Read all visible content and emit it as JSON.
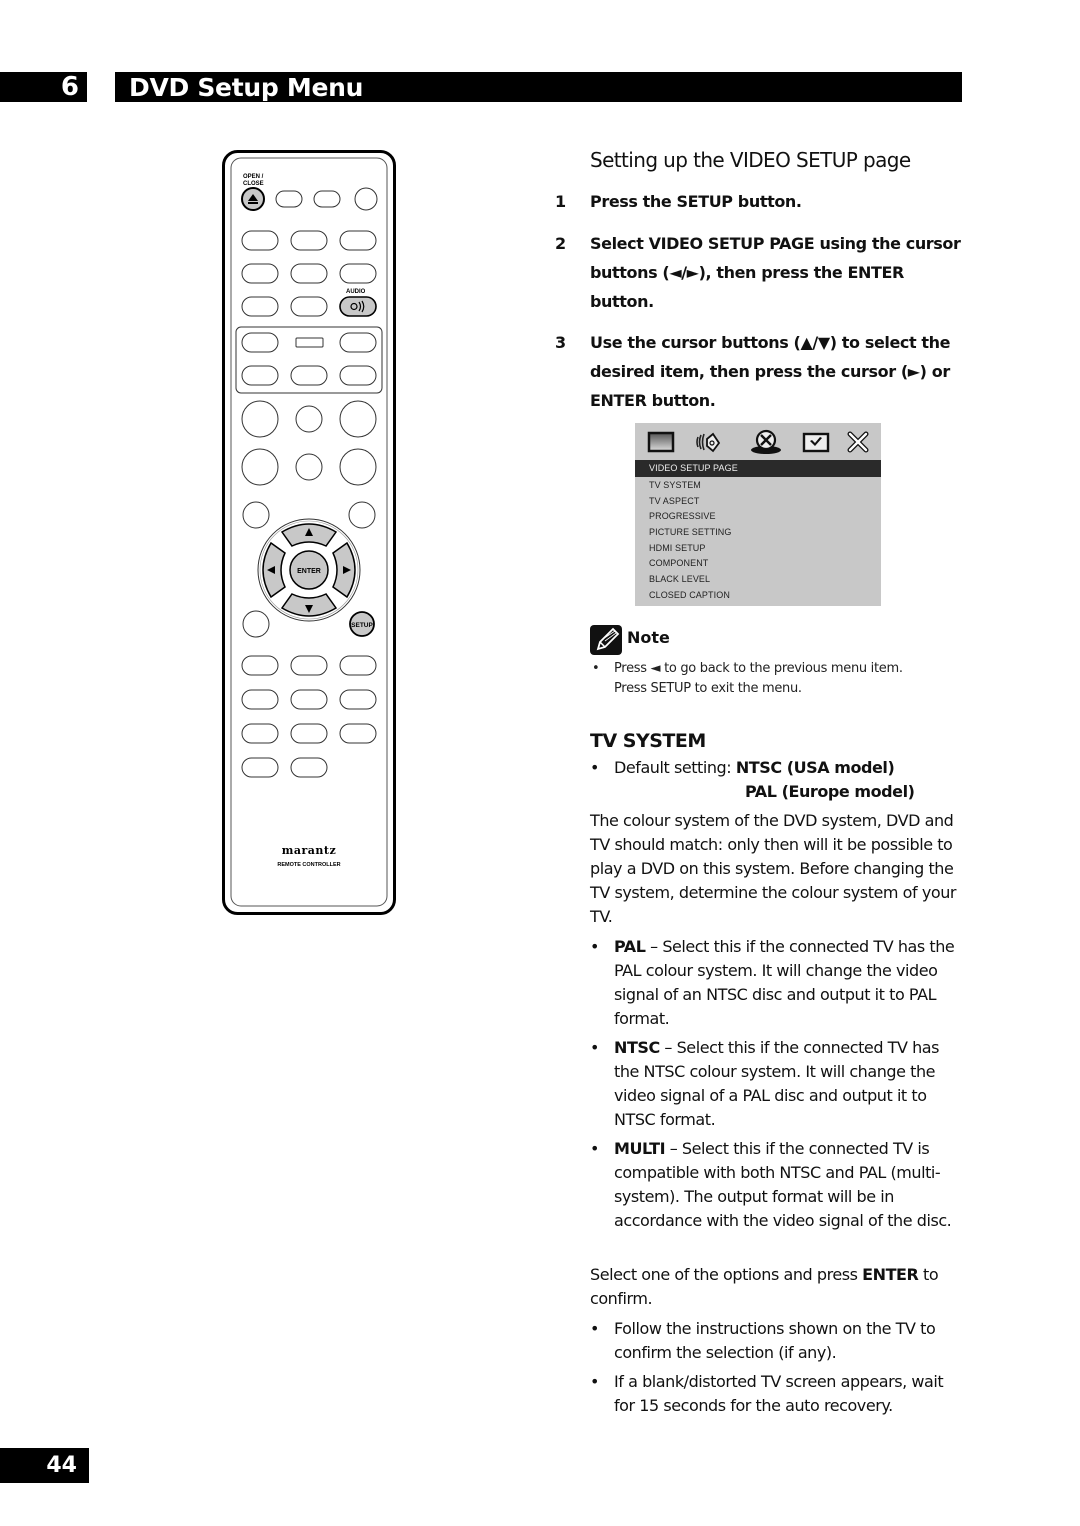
{
  "header": {
    "chapter_number": "6",
    "chapter_title": "DVD Setup Menu"
  },
  "remote": {
    "open_close_label": "OPEN /\nCLOSE",
    "open_close_line1": "OPEN /",
    "open_close_line2": "CLOSE",
    "audio_label": "AUDIO",
    "enter_label": "ENTER",
    "setup_label": "SETUP",
    "brand": "marantz",
    "model_label": "REMOTE CONTROLLER"
  },
  "section": {
    "title": "Setting up the VIDEO SETUP page",
    "steps": [
      {
        "number": "1",
        "text": "Press the SETUP button."
      },
      {
        "number": "2",
        "text": "Select VIDEO SETUP PAGE using the cursor buttons (◄/►), then press the ENTER button."
      },
      {
        "number": "3",
        "text": "Use the cursor buttons (▲/▼) to select the desired item, then press the cursor (►) or ENTER button."
      }
    ]
  },
  "osd_menu": {
    "icons": [
      "general-setup-icon",
      "audio-setup-icon",
      "video-setup-icon",
      "preference-icon",
      "exit-icon"
    ],
    "items": [
      {
        "label": "VIDEO SETUP PAGE",
        "selected": true
      },
      {
        "label": "TV SYSTEM",
        "selected": false
      },
      {
        "label": "TV ASPECT",
        "selected": false
      },
      {
        "label": "PROGRESSIVE",
        "selected": false
      },
      {
        "label": "PICTURE SETTING",
        "selected": false
      },
      {
        "label": "HDMI SETUP",
        "selected": false
      },
      {
        "label": "COMPONENT",
        "selected": false
      },
      {
        "label": "BLACK LEVEL",
        "selected": false
      },
      {
        "label": "CLOSED CAPTION",
        "selected": false
      }
    ]
  },
  "note": {
    "title": "Note",
    "bullet": "•",
    "line1": "Press ◄ to go back to the previous menu item.",
    "line2": "Press SETUP to exit the menu."
  },
  "tv_system": {
    "title": "TV SYSTEM",
    "default_label": "Default setting: ",
    "default_value_1": "NTSC (USA model)",
    "default_value_2": "PAL (Europe model)",
    "intro": "The colour system of the DVD system, DVD and TV should match: only then will it be possible to play a DVD on this system. Before changing the TV system, determine the colour system of your TV.",
    "options": [
      {
        "name": "PAL",
        "desc": " – Select this if the connected TV has the PAL colour system. It will change the video signal of an NTSC disc and output it to PAL format."
      },
      {
        "name": "NTSC",
        "desc": " – Select this if the connected TV has the NTSC colour system. It will change the video signal of a PAL disc and output it to NTSC format."
      },
      {
        "name": "MULTI",
        "desc": " – Select this if the connected TV is compatible with both NTSC and PAL (multi-system). The output format will be in accordance with the video signal of the disc."
      }
    ],
    "confirm_pre": "Select one of the options and press ",
    "confirm_bold": "ENTER",
    "confirm_post": " to confirm.",
    "tips": [
      "Follow the instructions shown on the TV to confirm the selection (if any).",
      "If a blank/distorted TV screen appears, wait for 15 seconds for the auto recovery."
    ]
  },
  "footer": {
    "page_number": "44"
  }
}
